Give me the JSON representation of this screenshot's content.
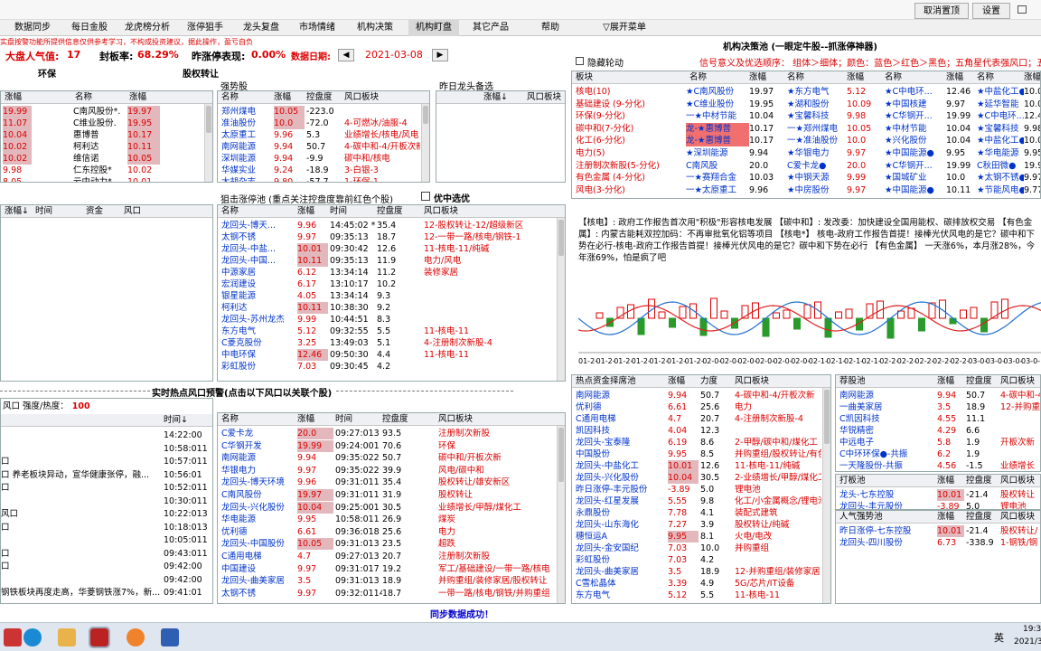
{
  "top_bar": {
    "btn1": "取消置顶",
    "btn2": "设置"
  },
  "menu": [
    "数据同步",
    "每日金股",
    "龙虎榜分析",
    "涨停狙手",
    "龙头复盘",
    "市场情绪",
    "机构决策",
    "机构盯盘",
    "其它产品",
    "帮助",
    "展开菜单"
  ],
  "notice": "实盘按警功能所提供信息仅供参考学习，不构成投资建议，据此操作，盈亏自负",
  "stats": {
    "sentiment_label": "大盘人气值:",
    "sentiment_value": "17",
    "seal_label": "封板率:",
    "seal_value": "68.29%",
    "yest_label": "昨涨停表现:",
    "yest_value": "0.00%",
    "date_label": "数据日期:",
    "date_value": "2021-03-08"
  },
  "sections": {
    "env": "环保",
    "transfer": "股权转让",
    "strong": "强势股",
    "yest_leader": "昨日龙头备选",
    "snipe": "狙击涨停池 (重点关注控盘度靠前红色个股)",
    "pref": "优中选优",
    "hot_warn": "实时热点风口预警(点击以下风口以关联个股)",
    "inst_title": "机构决策池 (一眼定牛股--抓涨停神器)",
    "hide_rotate": "隐藏轮动",
    "signal_order": "信号意义及优选顺序：  组体＞细体；颜色：蓝色＞红色＞黑色；五角星代表强风口；五"
  },
  "env_table": {
    "h": [
      "涨幅",
      "名称",
      "涨幅"
    ],
    "rows": [
      [
        "19.99",
        "C南风股份*.",
        "19.97"
      ],
      [
        "11.07",
        "C维业股份.",
        "19.95"
      ],
      [
        "10.04",
        "惠博普",
        "10.17"
      ],
      [
        "10.02",
        "柯利达",
        "10.11"
      ],
      [
        "10.02",
        "维信诺",
        "10.05"
      ],
      [
        "9.98",
        "仁东控股*",
        "10.02"
      ],
      [
        "8.05",
        "云中动力*",
        "10.01"
      ]
    ]
  },
  "strong_table": {
    "h": [
      "名称",
      "涨幅",
      "控盘度",
      "风口板块"
    ],
    "rows": [
      [
        "郑州煤电",
        "10.05",
        "-223.0",
        ""
      ],
      [
        "准油股份",
        "10.0",
        "-72.0",
        "4-可燃冰/油服-4"
      ],
      [
        "太原重工",
        "9.96",
        "5.3",
        "业绩增长/核电/风电"
      ],
      [
        "南网能源",
        "9.94",
        "50.7",
        "4-碳中和-4/开板次新"
      ],
      [
        "深圳能源",
        "9.94",
        "-9.9",
        "碳中和/核电"
      ],
      [
        "华媒实业",
        "9.24",
        "-18.9",
        "3-白银-3"
      ],
      [
        "大胡杂志",
        "9.80",
        "-57.7",
        "1-环保-1"
      ]
    ]
  },
  "yest_table": {
    "h": [
      "涨幅↓",
      "风口板块"
    ]
  },
  "left_mid": {
    "h": [
      "涨幅↓",
      "时间",
      "资金",
      "风口"
    ]
  },
  "snipe_table": {
    "h": [
      "名称",
      "涨幅",
      "时间",
      "控盘度",
      "风口板块"
    ],
    "rows": [
      [
        "龙回头-博天...",
        "9.96",
        "14:45:02 *",
        "35.4",
        "12-股权转让-12/超级新区"
      ],
      [
        "太钢不锈",
        "9.97",
        "09:35:13",
        "18.7",
        "12-一带一路/核电/钢铁-1"
      ],
      [
        "龙回头-中盐...",
        "10.01",
        "09:30:42",
        "12.6",
        "11-核电-11/纯碱"
      ],
      [
        "龙回头-中国...",
        "10.11",
        "09:35:13",
        "11.9",
        "电力/风电"
      ],
      [
        "中源家居",
        "6.12",
        "13:34:14",
        "11.2",
        "装修家居"
      ],
      [
        "宏润建设",
        "6.17",
        "13:10:17",
        "10.2",
        ""
      ],
      [
        "银星能源",
        "4.05",
        "13:34:14",
        "9.3",
        ""
      ],
      [
        "柯利达",
        "10.11",
        "10:38:30",
        "9.2",
        ""
      ],
      [
        "龙回头-苏州龙杰",
        "9.99",
        "10:44:51",
        "8.3",
        ""
      ],
      [
        "东方电气",
        "5.12",
        "09:32:55",
        "5.5",
        "11-核电-11"
      ],
      [
        "C菱克股份",
        "3.25",
        "13:49:03",
        "5.1",
        "4-注册制次新股-4"
      ],
      [
        "中电环保",
        "12.46",
        "09:50:30",
        "4.4",
        "11-核电-11"
      ],
      [
        "彩虹股份",
        "7.03",
        "09:30:45",
        "4.2",
        ""
      ]
    ]
  },
  "bottom_left": {
    "head": "风口 强度/热度：",
    "head_value": "100",
    "h": [
      "时间↓"
    ],
    "rows": [
      [
        "",
        "14:22:00"
      ],
      [
        "",
        "10:58:011"
      ],
      [
        "口",
        "10:57:011"
      ],
      [
        "口 养老板块异动，宣华健康张停，融...",
        "10:56:01"
      ],
      [
        "口",
        "10:52:011"
      ],
      [
        "",
        "10:30:011"
      ],
      [
        "风口",
        "10:22:013"
      ],
      [
        "口",
        "10:18:013"
      ],
      [
        "",
        "10:05:011"
      ],
      [
        "口",
        "09:43:011"
      ],
      [
        "口",
        "09:42:00"
      ],
      [
        "",
        "09:42:00"
      ],
      [
        "钢铁板块再度走高，华菱钢铁涨7%，新...",
        "09:41:01"
      ]
    ]
  },
  "bottom_mid": {
    "h": [
      "名称",
      "涨幅",
      "时间",
      "控盘度",
      "风口板块"
    ],
    "rows": [
      [
        "C爱卡龙",
        "20.0",
        "09:27:013",
        "93.5",
        "注册制次新股"
      ],
      [
        "C华钢开发",
        "19.99",
        "09:24:001",
        "70.6",
        "环保"
      ],
      [
        "南网能源",
        "9.94",
        "09:35:022",
        "50.7",
        "碳中和/开板次新"
      ],
      [
        "华银电力",
        "9.97",
        "09:35:022",
        "39.9",
        "风电/碳中和"
      ],
      [
        "龙回头-博天环境",
        "9.96",
        "09:31:011",
        "35.4",
        "股权转让/雄安新区"
      ],
      [
        "C南风股份",
        "19.97",
        "09:31:011",
        "31.9",
        "股权转让"
      ],
      [
        "龙回头-兴化股份",
        "10.04",
        "09:25:001",
        "30.5",
        "业绩增长/甲醇/煤化工"
      ],
      [
        "华电能源",
        "9.95",
        "10:58:011",
        "26.9",
        "煤炭"
      ],
      [
        "优利德",
        "6.61",
        "09:36:018",
        "25.6",
        "电力"
      ],
      [
        "龙回头-中国股份",
        "10.05",
        "09:31:013",
        "23.5",
        "超跌"
      ],
      [
        "C通用电梯",
        "4.7",
        "09:27:013",
        "20.7",
        "注册制次新股"
      ],
      [
        "中国建设",
        "9.97",
        "09:31:017",
        "19.2",
        "军工/基础建设/一带一路/核电"
      ],
      [
        "龙回头-曲美家居",
        "3.5",
        "09:31:013",
        "18.9",
        "并购重组/装修家居/股权转让"
      ],
      [
        "太钢不锈",
        "9.97",
        "09:32:0114",
        "18.7",
        "一带一路/核电/钢铁/并购重组"
      ]
    ]
  },
  "status_bar": "同步数据成功！",
  "inst_table": {
    "h": [
      "板块",
      "名称",
      "涨幅",
      "名称",
      "涨幅",
      "名称",
      "涨幅",
      "名称",
      "涨幅"
    ],
    "rows": [
      [
        "核电(10)",
        "★C南风股份",
        "19.97",
        "★东方电气",
        "5.12",
        "★C中电环...",
        "12.46",
        "★中盐化工●",
        "10.01"
      ],
      [
        "基础建设 (9-分化)",
        "★C维业股份",
        "19.95",
        "★湖和股份",
        "10.09",
        "★中国核建",
        "9.97",
        "★延华智能",
        "10.07"
      ],
      [
        "环保(9-分化)",
        "一★中材节能",
        "10.04",
        "★宝馨科技",
        "9.98",
        "★C华钢开...",
        "19.99",
        "★C中电环...",
        "12.46"
      ],
      [
        "碳中和(7-分化)",
        "龙-★惠博普",
        "10.17",
        "一★郑州煤电",
        "10.05",
        "★中材节能",
        "10.04",
        "★宝馨科技",
        "9.98"
      ],
      [
        "化工(6-分化)",
        "龙-★惠博普",
        "10.17",
        "一★准油股份",
        "10.0",
        "★兴化股份",
        "10.04",
        "★中盐化工●",
        "10.01"
      ],
      [
        "电力(5)",
        "★深圳能源",
        "9.94",
        "★华银电力",
        "9.97",
        "★中国能源●",
        "9.95",
        "★华电能源",
        "9.95"
      ],
      [
        "注册制次新股(5-分化)",
        "C南风股",
        "20.0",
        "C爱卡龙●",
        "20.0",
        "★C华钢开...",
        "19.99",
        "C秋田微●",
        "19.97"
      ],
      [
        "有色金属 (4-分化)",
        "一★赛翔合金",
        "10.03",
        "★中钢天源",
        "9.99",
        "★国城矿业",
        "10.0",
        "★太钢不锈●",
        "9.97"
      ],
      [
        "风电(3-分化)",
        "一★太原重工",
        "9.96",
        "★中房股份",
        "9.97",
        "★中国能源●",
        "10.11",
        "★节能风电●",
        "9.77"
      ]
    ]
  },
  "news": {
    "text": "【核电】: 政府工作报告首次用\"积极\"形容核电发展 【碳中和】: 发改委：加快建设全国用能权、碳排放权交易 【有色金属】: 内蒙古能耗双控加码：不再审批氧化铝等项目 【核电*】 核电-政府工作报告首提！接棒光伏风电的是它？碳中和下势在必行-核电-政府工作报告首提！接棒光伏风电的是它？碳中和下势在必行 【有色金属】 一天涨6%，本月涨28%，今年涨69%，怕是疯了吧"
  },
  "chart_data": {
    "type": "bar",
    "title": "",
    "x_tick_labels": [
      "01-2",
      "01-2",
      "01-2",
      "01-2",
      "01-2",
      "01-2",
      "01-2",
      "02-0",
      "02-0",
      "02-0",
      "02-0",
      "02-0",
      "02-0",
      "02-1",
      "02-1",
      "02-1",
      "02-1",
      "02-2",
      "02-2",
      "02-2",
      "02-2",
      "02-2",
      "03-0",
      "03-0",
      "03-0",
      "03-0"
    ]
  },
  "hot_fund": {
    "h": [
      "热点资金择席池",
      "涨幅",
      "力度",
      "风口板块"
    ],
    "rows": [
      [
        "南网能源",
        "9.94",
        "50.7",
        "4-碳中和-4/开板次新"
      ],
      [
        "优利德",
        "6.61",
        "25.6",
        "电力"
      ],
      [
        "C通用电梯",
        "4.7",
        "20.7",
        "4-注册制次新股-4"
      ],
      [
        "凯因科技",
        "4.04",
        "12.3",
        ""
      ],
      [
        "龙回头-宝泰隆",
        "6.19",
        "8.6",
        "2-甲醇/碳中和/煤化工"
      ],
      [
        "中国股份",
        "9.95",
        "8.5",
        "并购重组/股权转让/有色"
      ],
      [
        "龙回头-中盐化工",
        "10.01",
        "12.6",
        "11-核电-11/纯碱"
      ],
      [
        "龙回头-兴化股份",
        "10.04",
        "30.5",
        "2-业绩增长/甲醇/煤化工"
      ],
      [
        "昨日涨停-丰元股份",
        "-3.89",
        "5.0",
        "锂电池"
      ],
      [
        "龙回头-红星发展",
        "5.55",
        "9.8",
        "化工/小金属概念/锂电池"
      ],
      [
        "永鼎股份",
        "7.78",
        "4.1",
        "装配式建筑"
      ],
      [
        "龙回头-山东海化",
        "7.27",
        "3.9",
        "股权转让/纯碱"
      ],
      [
        "穗恒运A",
        "9.95",
        "8.1",
        "火电/电改"
      ],
      [
        "龙回头-金安国纪",
        "7.03",
        "10.0",
        "并购重组"
      ],
      [
        "彩虹股份",
        "7.03",
        "4.2",
        ""
      ],
      [
        "龙回头-曲美家居",
        "3.5",
        "18.9",
        "12-并购重组/装修家居"
      ],
      [
        "C雪松晶体",
        "3.39",
        "4.9",
        "5G/芯片/IT设备"
      ],
      [
        "东方电气",
        "5.12",
        "5.5",
        "11-核电-11"
      ]
    ]
  },
  "rec_pool": {
    "h": [
      "荐股池",
      "涨幅",
      "控盘度",
      "风口板块"
    ],
    "rows": [
      [
        "南网能源",
        "9.94",
        "50.7",
        "4-碳中和-4"
      ],
      [
        "一曲美家居",
        "3.5",
        "18.9",
        "12-并购重组"
      ],
      [
        "C凯因科技",
        "4.55",
        "11.1",
        ""
      ],
      [
        "华锐精密",
        "4.29",
        "6.6",
        ""
      ],
      [
        "中远电子",
        "5.8",
        "1.9",
        "开板次新"
      ],
      [
        "C中环环保●-共振",
        "6.2",
        "1.9",
        ""
      ],
      [
        "一天隆股份-共振",
        "4.56",
        "-1.5",
        "业绩增长"
      ]
    ]
  },
  "board_pool": {
    "h": [
      "打板池",
      "涨幅",
      "控盘度",
      "风口板块"
    ],
    "rows": [
      [
        "龙头-七东控股",
        "10.01",
        "-21.4",
        "股权转让"
      ],
      [
        "龙回头-丰元股份",
        "-3.89",
        "5.0",
        "锂电池"
      ]
    ]
  },
  "pop_pool": {
    "h": [
      "人气强势池",
      "涨幅",
      "控盘度",
      "风口板块"
    ],
    "rows": [
      [
        "昨日涨停-七东控股",
        "10.01",
        "-21.4",
        "股权转让/"
      ],
      [
        "龙回头-四川股份",
        "6.73",
        "-338.9",
        "1-钢铁/钢"
      ]
    ]
  },
  "taskbar": {
    "time": "19:3",
    "date": "2021/3/",
    "lang": "英"
  }
}
